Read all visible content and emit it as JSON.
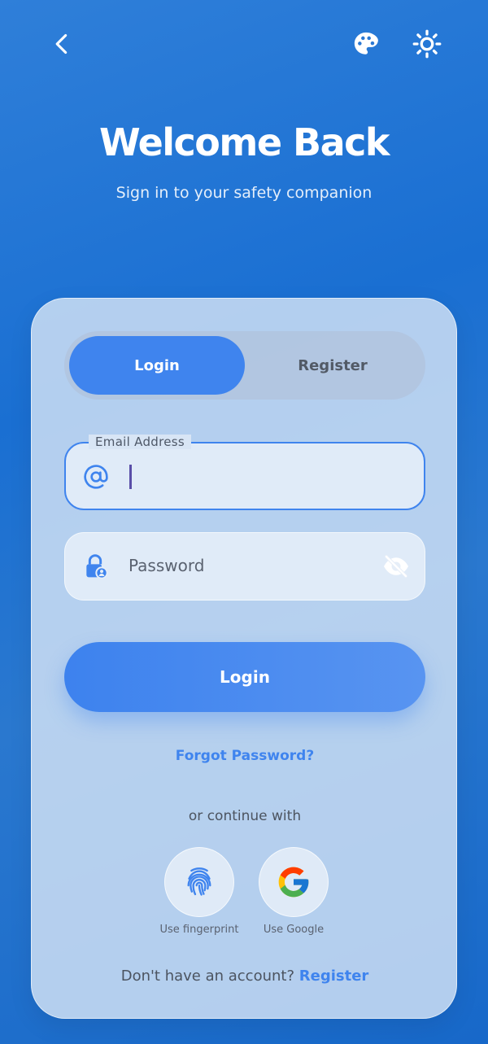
{
  "header": {
    "back_icon": "chevron-left-icon",
    "palette_icon": "palette-icon",
    "theme_icon": "sun-icon"
  },
  "hero": {
    "title": "Welcome Back",
    "subtitle": "Sign in to your safety companion"
  },
  "tabs": {
    "login_label": "Login",
    "register_label": "Register",
    "active": "Login"
  },
  "email_field": {
    "label": "Email Address",
    "value": "",
    "icon": "at-sign-icon"
  },
  "password_field": {
    "placeholder": "Password",
    "value": "",
    "icon": "lock-user-icon",
    "toggle_icon": "eye-off-icon"
  },
  "login_button": {
    "label": "Login"
  },
  "forgot_password": {
    "label": "Forgot Password?"
  },
  "social": {
    "divider_text": "or continue with",
    "fingerprint_label": "Use fingerprint",
    "google_label": "Use Google"
  },
  "footer": {
    "prompt": "Don't have an account?",
    "link_label": "Register"
  },
  "colors": {
    "accent": "#3f84ee",
    "background": "#1a6fd2",
    "card": "#d6e4f5"
  }
}
